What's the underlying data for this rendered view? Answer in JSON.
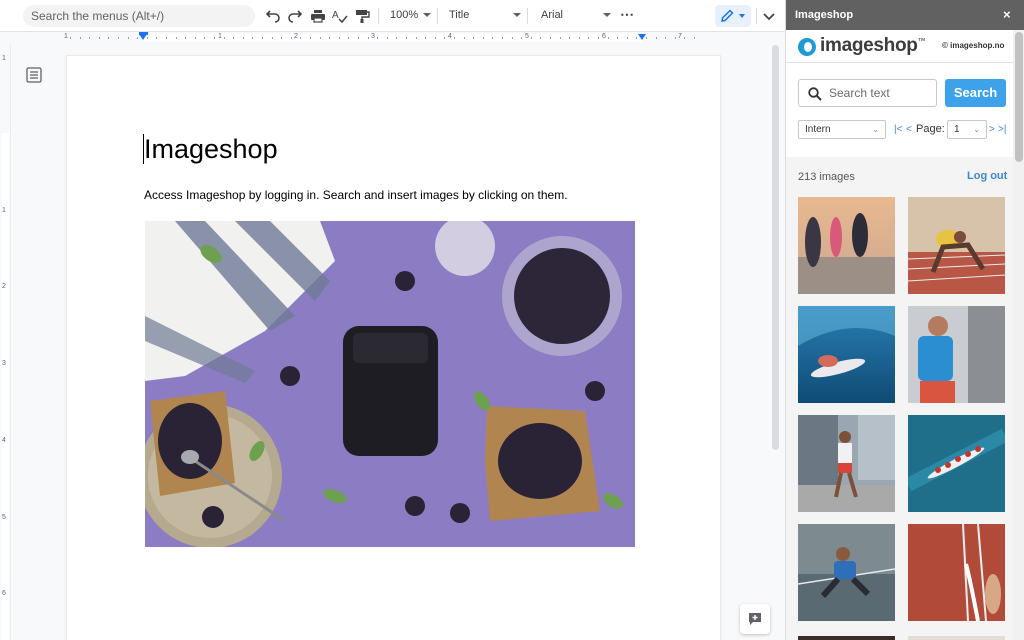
{
  "toolbar": {
    "menu_search_label": "Search the menus (Alt+/)",
    "zoom": "100%",
    "style": "Title",
    "font": "Arial",
    "more": "⋯"
  },
  "ruler": {
    "numbers": [
      "1",
      "1",
      "2",
      "3",
      "4",
      "5",
      "6",
      "7"
    ]
  },
  "vruler": {
    "numbers": [
      "1",
      "1",
      "2",
      "3",
      "4",
      "5",
      "6"
    ]
  },
  "document": {
    "title": "Imageshop",
    "body": "Access Imageshop by logging in. Search and insert images by clicking on them."
  },
  "sidebar": {
    "title": "Imageshop",
    "close": "×",
    "logo_text": "imageshop",
    "logo_tm": "™",
    "logo_domain": "© imageshop.no",
    "search_placeholder": "Search text",
    "search_button": "Search",
    "filter": "Intern",
    "pager": {
      "first": "|<",
      "prev": "<",
      "label": "Page:",
      "page": "1",
      "next": ">",
      "last": ">|"
    },
    "image_count": "213 images",
    "logout": "Log out"
  },
  "colors": {
    "accent": "#3da2ea",
    "link": "#3d86d6",
    "header": "#616161",
    "image_bg": "#8d7dc4"
  }
}
